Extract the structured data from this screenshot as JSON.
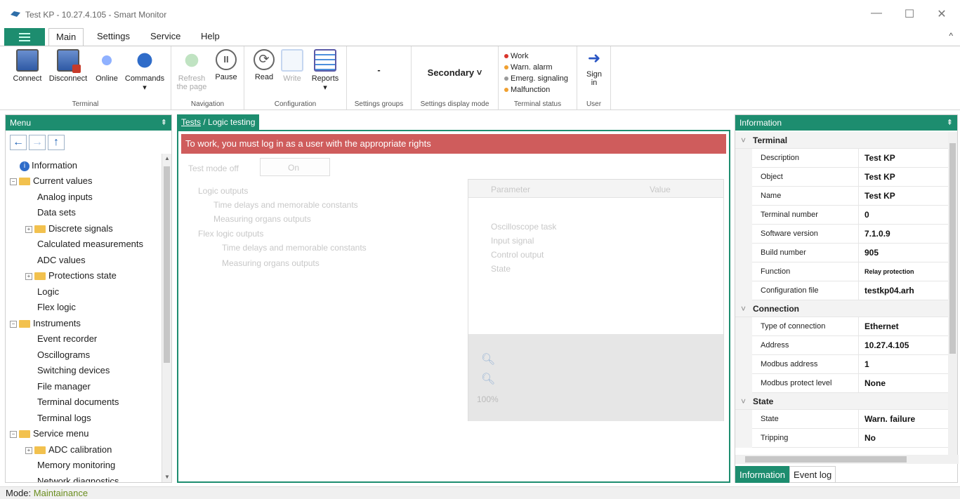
{
  "window": {
    "title": "Test KP - 10.27.4.105 - Smart Monitor",
    "minimize": "—",
    "maximize": "☐",
    "close": "✕"
  },
  "ribbon_tabs": [
    {
      "label": "Main",
      "active": true
    },
    {
      "label": "Settings"
    },
    {
      "label": "Service"
    },
    {
      "label": "Help"
    }
  ],
  "ribbon_collapse": "^",
  "ribbon": {
    "terminal": {
      "label": "Terminal",
      "connect": "Connect",
      "disconnect": "Disconnect",
      "online": "Online",
      "commands": "Commands",
      "commands_arrow": "▾"
    },
    "navigation": {
      "label": "Navigation",
      "refresh_line1": "Refresh",
      "refresh_line2": "the page",
      "pause": "Pause"
    },
    "configuration": {
      "label": "Configuration",
      "read": "Read",
      "write": "Write",
      "reports": "Reports",
      "reports_arrow": "▾"
    },
    "settings_groups": {
      "label": "Settings groups",
      "value": "-"
    },
    "settings_display_mode": {
      "label": "Settings display mode",
      "value": "Secondary ˅"
    },
    "terminal_status": {
      "label": "Terminal status",
      "items": [
        {
          "text": "Work",
          "color": "#d9342b"
        },
        {
          "text": "Warn. alarm",
          "color": "#f0a030"
        },
        {
          "text": "Emerg. signaling",
          "color": "#9b9b9b"
        },
        {
          "text": "Malfunction",
          "color": "#f0a030"
        }
      ]
    },
    "user": {
      "label": "User",
      "sign_line1": "Sign",
      "sign_line2": "in"
    }
  },
  "menu": {
    "title": "Menu",
    "pin": "⇞",
    "nav_back": "←",
    "nav_forward": "→",
    "nav_up": "↑",
    "items": [
      {
        "label": "Information"
      },
      {
        "label": "Current values"
      },
      {
        "label": "Analog inputs"
      },
      {
        "label": "Data sets"
      },
      {
        "label": "Discrete signals"
      },
      {
        "label": "Calculated measurements"
      },
      {
        "label": "ADC values"
      },
      {
        "label": "Protections state"
      },
      {
        "label": "Logic"
      },
      {
        "label": "Flex logic"
      },
      {
        "label": "Instruments"
      },
      {
        "label": "Event recorder"
      },
      {
        "label": "Oscillograms"
      },
      {
        "label": "Switching devices"
      },
      {
        "label": "File manager"
      },
      {
        "label": "Terminal documents"
      },
      {
        "label": "Terminal logs"
      },
      {
        "label": "Service menu"
      },
      {
        "label": "ADC calibration"
      },
      {
        "label": "Memory monitoring"
      },
      {
        "label": "Network diagnostics"
      }
    ]
  },
  "center": {
    "breadcrumb_link": "Tests",
    "breadcrumb_sep": " / ",
    "breadcrumb_current": "Logic testing",
    "alert": "To work, you must log in as a user with the appropriate rights",
    "ghost": {
      "test_mode": "Test mode off",
      "on": "On",
      "tree": [
        "Logic outputs",
        "Time delays and memorable constants",
        "Measuring organs outputs",
        "Flex logic outputs",
        "Time delays and memorable constants",
        "Measuring organs outputs"
      ],
      "param_header": "Parameter",
      "value_header": "Value",
      "rows": [
        "Oscilloscope task",
        "Input signal",
        "Control output",
        "State"
      ],
      "zoom": "100%"
    }
  },
  "information": {
    "title": "Information",
    "pin": "⇞",
    "categories": [
      {
        "name": "Terminal",
        "rows": [
          {
            "key": "Description",
            "value": "Test KP"
          },
          {
            "key": "Object",
            "value": "Test KP"
          },
          {
            "key": "Name",
            "value": "Test KP"
          },
          {
            "key": "Terminal number",
            "value": "0"
          },
          {
            "key": "Software version",
            "value": "7.1.0.9"
          },
          {
            "key": "Build number",
            "value": "905"
          },
          {
            "key": "Function",
            "value": "Relay protection"
          },
          {
            "key": "Configuration file",
            "value": "testkp04.arh"
          }
        ]
      },
      {
        "name": "Connection",
        "rows": [
          {
            "key": "Type of connection",
            "value": "Ethernet"
          },
          {
            "key": "Address",
            "value": "10.27.4.105"
          },
          {
            "key": "Modbus address",
            "value": "1"
          },
          {
            "key": "Modbus protect level",
            "value": "None"
          }
        ]
      },
      {
        "name": "State",
        "rows": [
          {
            "key": "State",
            "value": "Warn. failure"
          },
          {
            "key": "Tripping",
            "value": "No"
          }
        ]
      }
    ],
    "bottom_tabs": [
      {
        "label": "Information",
        "active": true
      },
      {
        "label": "Event log"
      }
    ]
  },
  "statusbar": {
    "mode_label": "Mode:",
    "mode_value": "Maintainance"
  }
}
